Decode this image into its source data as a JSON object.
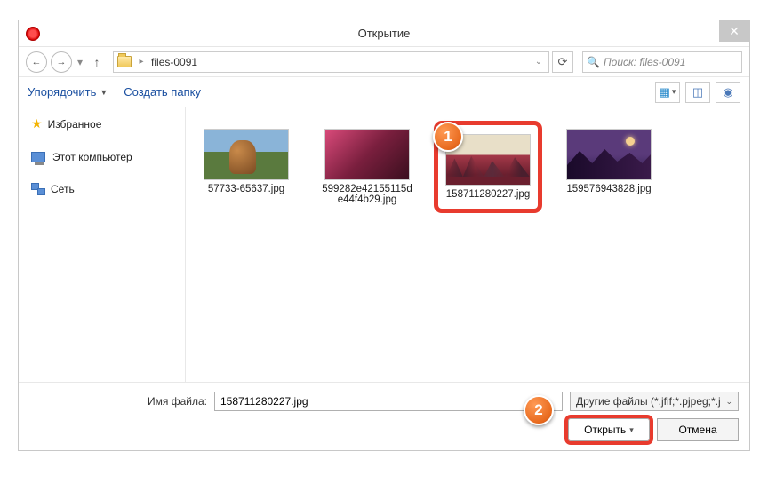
{
  "dialog": {
    "title": "Открытие",
    "close": "✕"
  },
  "nav": {
    "folder_name": "files-0091",
    "search_placeholder": "Поиск: files-0091"
  },
  "toolbar": {
    "organize": "Упорядочить",
    "new_folder": "Создать папку"
  },
  "sidebar": {
    "favorites": "Избранное",
    "this_pc": "Этот компьютер",
    "network": "Сеть"
  },
  "files": [
    {
      "name": "57733-65637.jpg",
      "selected": false
    },
    {
      "name": "599282e42155115de44f4b29.jpg",
      "selected": false
    },
    {
      "name": "158711280227.jpg",
      "selected": true
    },
    {
      "name": "159576943828.jpg",
      "selected": false
    }
  ],
  "bottom": {
    "filename_label": "Имя файла:",
    "filename_value": "158711280227.jpg",
    "filetype": "Другие файлы (*.jfif;*.pjpeg;*.j",
    "open": "Открыть",
    "cancel": "Отмена"
  },
  "callouts": {
    "one": "1",
    "two": "2"
  }
}
